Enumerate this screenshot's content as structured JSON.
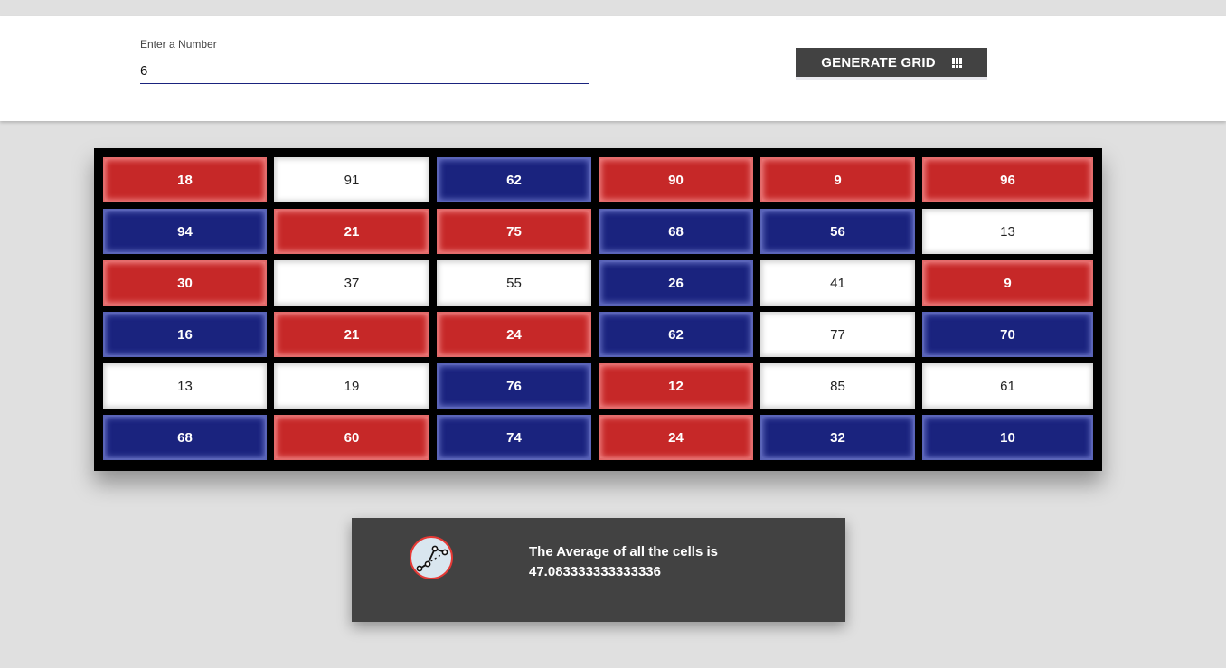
{
  "input": {
    "label": "Enter a Number",
    "value": "6"
  },
  "generate_button": {
    "label": "GENERATE GRID",
    "icon": "grid-icon"
  },
  "grid": {
    "size": 6,
    "colors": {
      "red": "#c62828",
      "blue": "#1a237e",
      "white": "#ffffff",
      "border": "#000000"
    },
    "rows": [
      [
        {
          "value": "18",
          "color": "red"
        },
        {
          "value": "91",
          "color": "white"
        },
        {
          "value": "62",
          "color": "blue"
        },
        {
          "value": "90",
          "color": "red"
        },
        {
          "value": "9",
          "color": "red"
        },
        {
          "value": "96",
          "color": "red"
        }
      ],
      [
        {
          "value": "94",
          "color": "blue"
        },
        {
          "value": "21",
          "color": "red"
        },
        {
          "value": "75",
          "color": "red"
        },
        {
          "value": "68",
          "color": "blue"
        },
        {
          "value": "56",
          "color": "blue"
        },
        {
          "value": "13",
          "color": "white"
        }
      ],
      [
        {
          "value": "30",
          "color": "red"
        },
        {
          "value": "37",
          "color": "white"
        },
        {
          "value": "55",
          "color": "white"
        },
        {
          "value": "26",
          "color": "blue"
        },
        {
          "value": "41",
          "color": "white"
        },
        {
          "value": "9",
          "color": "red"
        }
      ],
      [
        {
          "value": "16",
          "color": "blue"
        },
        {
          "value": "21",
          "color": "red"
        },
        {
          "value": "24",
          "color": "red"
        },
        {
          "value": "62",
          "color": "blue"
        },
        {
          "value": "77",
          "color": "white"
        },
        {
          "value": "70",
          "color": "blue"
        }
      ],
      [
        {
          "value": "13",
          "color": "white"
        },
        {
          "value": "19",
          "color": "white"
        },
        {
          "value": "76",
          "color": "blue"
        },
        {
          "value": "12",
          "color": "red"
        },
        {
          "value": "85",
          "color": "white"
        },
        {
          "value": "61",
          "color": "white"
        }
      ],
      [
        {
          "value": "68",
          "color": "blue"
        },
        {
          "value": "60",
          "color": "red"
        },
        {
          "value": "74",
          "color": "blue"
        },
        {
          "value": "24",
          "color": "red"
        },
        {
          "value": "32",
          "color": "blue"
        },
        {
          "value": "10",
          "color": "blue"
        }
      ]
    ]
  },
  "result": {
    "icon": "line-chart-icon",
    "line1": "The Average of all the cells is",
    "line2": "47.083333333333336"
  }
}
